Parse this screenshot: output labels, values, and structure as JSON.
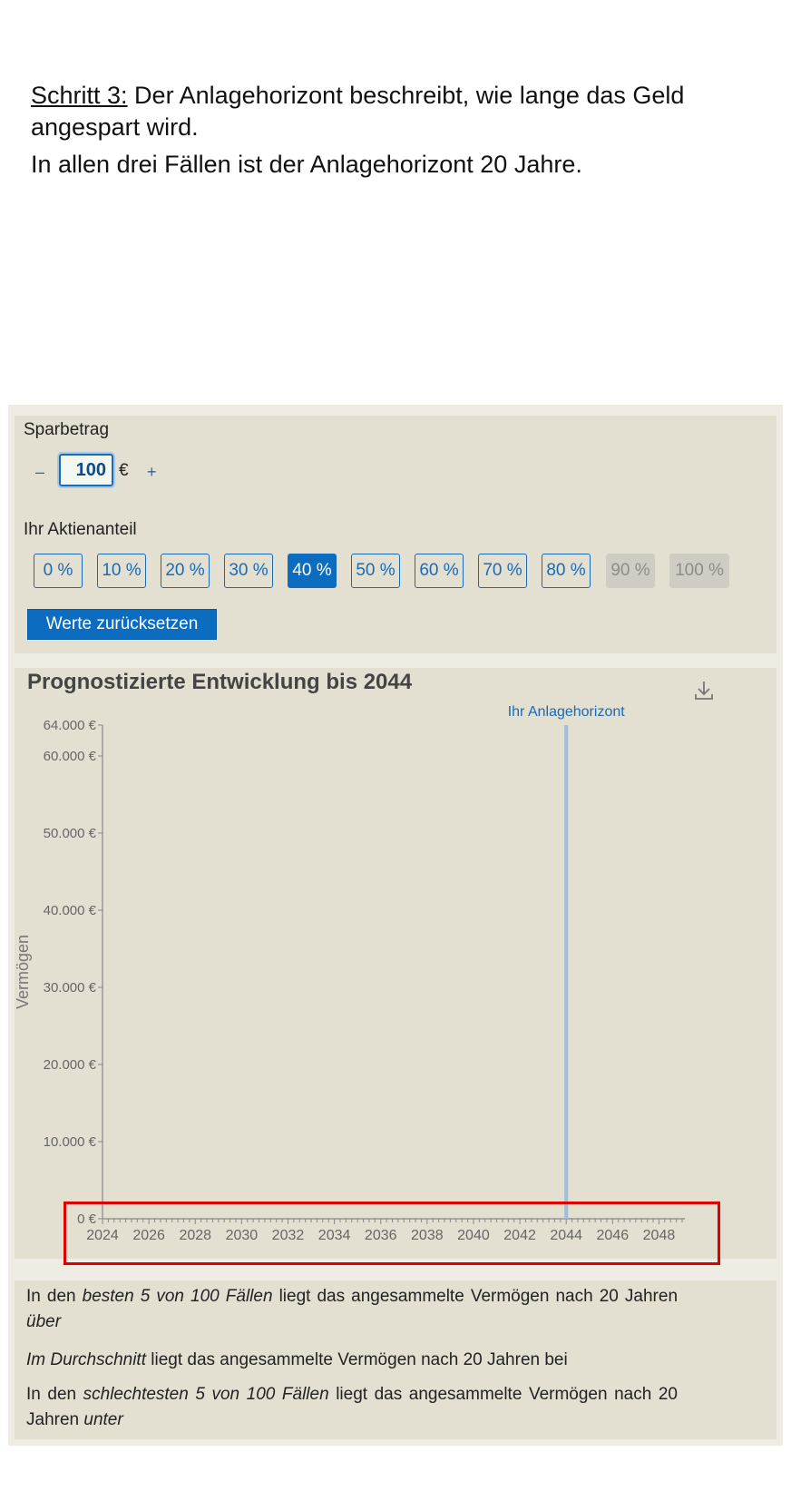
{
  "intro": {
    "step_label": "Schritt 3:",
    "step_text": " Der Anlagehorizont beschreibt, wie lange das Geld angespart wird.",
    "line2": "In allen drei Fällen ist der Anlagehorizont 20 Jahre."
  },
  "controls": {
    "savings_label": "Sparbetrag",
    "minus": "–",
    "amount": "100",
    "currency": "€",
    "plus": "+",
    "share_label": "Ihr Aktienanteil",
    "share_options": [
      "0 %",
      "10 %",
      "20 %",
      "30 %",
      "40 %",
      "50 %",
      "60 %",
      "70 %",
      "80 %",
      "90 %",
      "100 %"
    ],
    "share_selected": "40 %",
    "share_disabled": [
      "90 %",
      "100 %"
    ],
    "reset_label": "Werte zurücksetzen",
    "accent_color": "#0b6cc0"
  },
  "chart_data": {
    "type": "line",
    "title": "Prognostizierte Entwicklung bis 2044",
    "ylabel": "Vermögen",
    "xlabel": "",
    "y_ticks": [
      "0 €",
      "10.000 €",
      "20.000 €",
      "30.000 €",
      "40.000 €",
      "50.000 €",
      "60.000 €",
      "64.000 €"
    ],
    "y_tick_values": [
      0,
      10000,
      20000,
      30000,
      40000,
      50000,
      60000,
      64000
    ],
    "ylim": [
      0,
      64000
    ],
    "x_ticks": [
      "2024",
      "2026",
      "2028",
      "2030",
      "2032",
      "2034",
      "2036",
      "2038",
      "2040",
      "2042",
      "2044",
      "2046",
      "2048"
    ],
    "xlim": [
      2024,
      2049
    ],
    "series": [],
    "horizon_marker": {
      "x": 2044,
      "label": "Ihr Anlagehorizont"
    },
    "download_icon": "download-icon",
    "highlight_color": "#e10000"
  },
  "results": {
    "best_prefix": "In den ",
    "best_em": "besten 5 von 100 Fällen",
    "best_mid": " liegt das angesammelte Vermögen nach 20 Jahren ",
    "best_end": "über",
    "avg_em": "Im Durchschnitt",
    "avg_rest": " liegt das angesammelte Vermögen nach 20 Jahren bei",
    "worst_prefix": "In den ",
    "worst_em": "schlechtesten 5 von 100 Fällen",
    "worst_mid": " liegt das angesammelte Vermögen nach 20 Jahren ",
    "worst_end": "unter"
  }
}
